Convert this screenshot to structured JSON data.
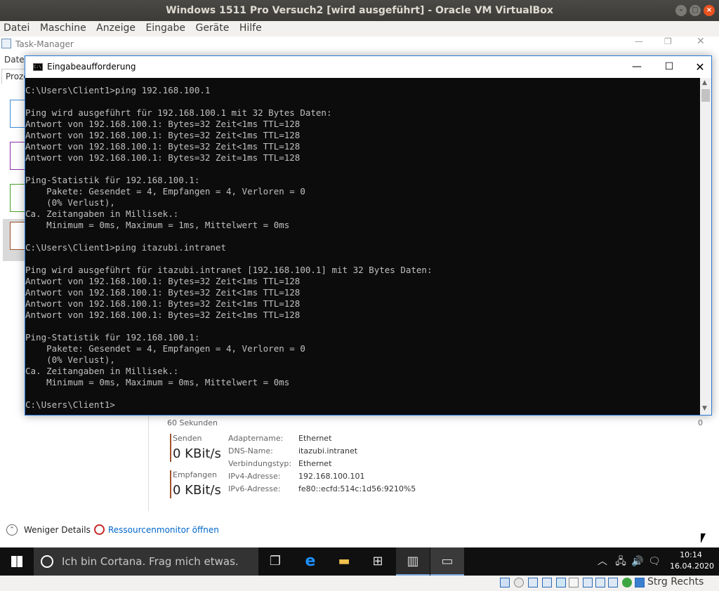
{
  "vbox": {
    "title": "Windows 1511 Pro Versuch2 [wird ausgeführt] - Oracle VM VirtualBox",
    "menu": [
      "Datei",
      "Maschine",
      "Anzeige",
      "Eingabe",
      "Geräte",
      "Hilfe"
    ],
    "host_key": "Strg Rechts"
  },
  "taskmgr": {
    "title": "Task-Manager",
    "menu_first": "Datei",
    "tab_first": "Proze",
    "axis_left": "60 Sekunden",
    "axis_right": "0",
    "send_label": "Senden",
    "send_value": "0 KBit/s",
    "recv_label": "Empfangen",
    "recv_value": "0 KBit/s",
    "props": [
      {
        "k": "Adaptername:",
        "v": "Ethernet"
      },
      {
        "k": "DNS-Name:",
        "v": "itazubi.intranet"
      },
      {
        "k": "Verbindungstyp:",
        "v": "Ethernet"
      },
      {
        "k": "IPv4-Adresse:",
        "v": "192.168.100.101"
      },
      {
        "k": "IPv6-Adresse:",
        "v": "fe80::ecfd:514c:1d56:9210%5"
      }
    ],
    "less_details": "Weniger Details",
    "resmon": "Ressourcenmonitor öffnen"
  },
  "cmd": {
    "title": "Eingabeaufforderung",
    "lines": [
      "C:\\Users\\Client1>ping 192.168.100.1",
      "",
      "Ping wird ausgeführt für 192.168.100.1 mit 32 Bytes Daten:",
      "Antwort von 192.168.100.1: Bytes=32 Zeit<1ms TTL=128",
      "Antwort von 192.168.100.1: Bytes=32 Zeit<1ms TTL=128",
      "Antwort von 192.168.100.1: Bytes=32 Zeit<1ms TTL=128",
      "Antwort von 192.168.100.1: Bytes=32 Zeit=1ms TTL=128",
      "",
      "Ping-Statistik für 192.168.100.1:",
      "    Pakete: Gesendet = 4, Empfangen = 4, Verloren = 0",
      "    (0% Verlust),",
      "Ca. Zeitangaben in Millisek.:",
      "    Minimum = 0ms, Maximum = 1ms, Mittelwert = 0ms",
      "",
      "C:\\Users\\Client1>ping itazubi.intranet",
      "",
      "Ping wird ausgeführt für itazubi.intranet [192.168.100.1] mit 32 Bytes Daten:",
      "Antwort von 192.168.100.1: Bytes=32 Zeit<1ms TTL=128",
      "Antwort von 192.168.100.1: Bytes=32 Zeit<1ms TTL=128",
      "Antwort von 192.168.100.1: Bytes=32 Zeit<1ms TTL=128",
      "Antwort von 192.168.100.1: Bytes=32 Zeit<1ms TTL=128",
      "",
      "Ping-Statistik für 192.168.100.1:",
      "    Pakete: Gesendet = 4, Empfangen = 4, Verloren = 0",
      "    (0% Verlust),",
      "Ca. Zeitangaben in Millisek.:",
      "    Minimum = 0ms, Maximum = 0ms, Mittelwert = 0ms",
      "",
      "C:\\Users\\Client1>"
    ]
  },
  "taskbar": {
    "search_placeholder": "Ich bin Cortana. Frag mich etwas.",
    "time": "10:14",
    "date": "16.04.2020"
  },
  "colors": {
    "accent": "#0078d7",
    "cmd_bg": "#0c0c0c",
    "cmd_fg": "#c0c0c0",
    "ubuntu_title": "#3c3b37"
  }
}
